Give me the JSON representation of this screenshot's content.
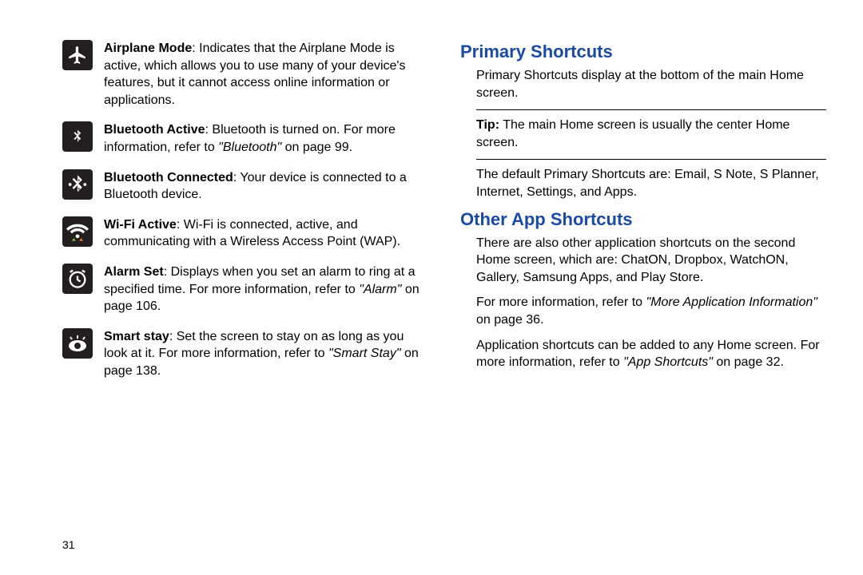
{
  "page_number": "31",
  "left_items": [
    {
      "label": "Airplane Mode",
      "text": ": Indicates that the Airplane Mode is active, which allows you to use many of your device's features, but it cannot access online information or applications.",
      "ref": "",
      "after": ""
    },
    {
      "label": "Bluetooth Active",
      "text": ": Bluetooth is turned on. For more information, refer to ",
      "ref": "\"Bluetooth\"",
      "after": " on page 99."
    },
    {
      "label": "Bluetooth Connected",
      "text": ": Your device is connected to a Bluetooth device.",
      "ref": "",
      "after": ""
    },
    {
      "label": "Wi-Fi Active",
      "text": ": Wi-Fi is connected, active, and communicating with a Wireless Access Point (WAP).",
      "ref": "",
      "after": ""
    },
    {
      "label": "Alarm Set",
      "text": ": Displays when you set an alarm to ring at a specified time. For more information, refer to ",
      "ref": "\"Alarm\"",
      "after": " on page 106."
    },
    {
      "label": "Smart stay",
      "text": ": Set the screen to stay on as long as you look at it. For more information, refer to ",
      "ref": "\"Smart Stay\"",
      "after": " on page 138."
    }
  ],
  "right": {
    "h1": "Primary Shortcuts",
    "p1": "Primary Shortcuts display at the bottom of the main Home screen.",
    "tip_label": "Tip:",
    "tip_text": " The main Home screen is usually the center Home screen.",
    "p2": "The default Primary Shortcuts are: Email, S Note, S Planner, Internet, Settings, and Apps.",
    "h2": "Other App Shortcuts",
    "p3": "There are also other application shortcuts on the second Home screen, which are: ChatON, Dropbox, WatchON, Gallery, Samsung Apps, and Play Store.",
    "p4a": "For more information, refer to ",
    "p4_ref": "\"More Application Information\"",
    "p4b": " on page 36.",
    "p5a": "Application shortcuts can be added to any Home screen. For more information, refer to ",
    "p5_ref": "\"App Shortcuts\"",
    "p5b": " on page 32."
  }
}
